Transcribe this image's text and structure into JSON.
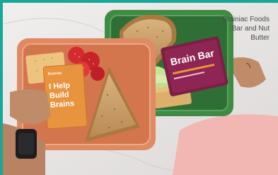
{
  "caption": {
    "line1": "Brainiac Foods",
    "line2": "Bar and Nut",
    "line3": "Butter"
  },
  "packet": {
    "brand": "Brainiac",
    "line1": "I Help",
    "line2": "Build",
    "line3": "Brains"
  },
  "bar": {
    "label": "Brain Bar"
  },
  "colors": {
    "frame": "#16a99a",
    "counter": "#e9e7e6",
    "orange_container": "#e08a63",
    "green_container": "#3f8a45",
    "packet": "#e8943e",
    "bar_wrapper": "#7a1f46"
  }
}
